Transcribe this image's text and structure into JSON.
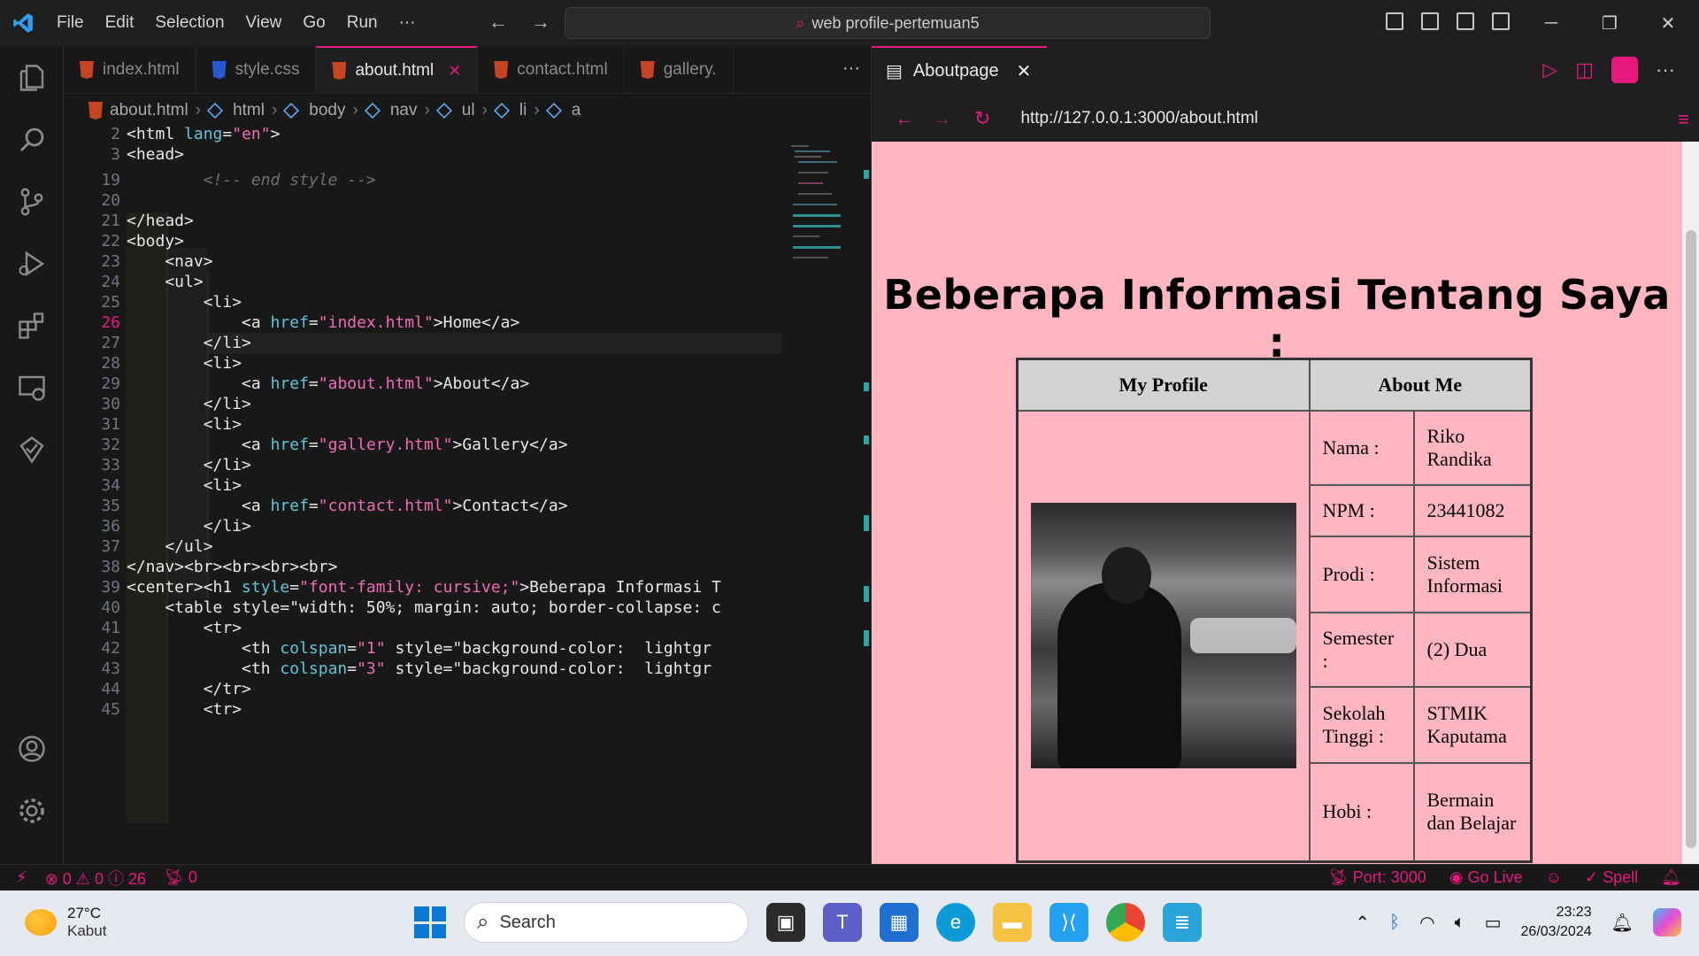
{
  "titlebar": {
    "menu": [
      "File",
      "Edit",
      "Selection",
      "View",
      "Go",
      "Run",
      "···"
    ],
    "search_text": "web profile-pertemuan5"
  },
  "editor": {
    "tabs": [
      {
        "label": "index.html",
        "type": "html"
      },
      {
        "label": "style.css",
        "type": "css"
      },
      {
        "label": "about.html",
        "type": "html",
        "active": true
      },
      {
        "label": "contact.html",
        "type": "html"
      },
      {
        "label": "gallery.",
        "type": "html"
      }
    ],
    "more": "···",
    "breadcrumb": [
      "about.html",
      "html",
      "body",
      "nav",
      "ul",
      "li",
      "a"
    ],
    "lines": [
      {
        "n": "2",
        "code": "<html lang=\"en\">"
      },
      {
        "n": "3",
        "code": "<head>"
      },
      {
        "n": "19",
        "code": "        <!-- end style -->"
      },
      {
        "n": "20",
        "code": ""
      },
      {
        "n": "21",
        "code": "</head>"
      },
      {
        "n": "22",
        "code": "<body>"
      },
      {
        "n": "23",
        "code": "    <nav>"
      },
      {
        "n": "24",
        "code": "    <ul>"
      },
      {
        "n": "25",
        "code": "        <li>"
      },
      {
        "n": "26",
        "code": "            <a href=\"index.html\">Home</a>"
      },
      {
        "n": "27",
        "code": "        </li>"
      },
      {
        "n": "28",
        "code": "        <li>"
      },
      {
        "n": "29",
        "code": "            <a href=\"about.html\">About</a>"
      },
      {
        "n": "30",
        "code": "        </li>"
      },
      {
        "n": "31",
        "code": "        <li>"
      },
      {
        "n": "32",
        "code": "            <a href=\"gallery.html\">Gallery</a>"
      },
      {
        "n": "33",
        "code": "        </li>"
      },
      {
        "n": "34",
        "code": "        <li>"
      },
      {
        "n": "35",
        "code": "            <a href=\"contact.html\">Contact</a>"
      },
      {
        "n": "36",
        "code": "        </li>"
      },
      {
        "n": "37",
        "code": "    </ul>"
      },
      {
        "n": "38",
        "code": "</nav><br><br><br><br>"
      },
      {
        "n": "39",
        "code": "<center><h1 style=\"font-family: cursive;\">Beberapa Informasi T"
      },
      {
        "n": "40",
        "code": "    <table style=\"width: 50%; margin: auto; border-collapse: c"
      },
      {
        "n": "41",
        "code": "        <tr>"
      },
      {
        "n": "42",
        "code": "            <th colspan=\"1\" style=\"background-color:  lightgr"
      },
      {
        "n": "43",
        "code": "            <th colspan=\"3\" style=\"background-color:  lightgr"
      },
      {
        "n": "44",
        "code": "        </tr>"
      },
      {
        "n": "45",
        "code": "        <tr>"
      }
    ]
  },
  "preview": {
    "tab_label": "Aboutpage",
    "url": "http://127.0.0.1:3000/about.html",
    "heading": "Beberapa Informasi Tentang Saya :",
    "table_headers": [
      "My Profile",
      "About Me"
    ],
    "rows": [
      {
        "label": "Nama :",
        "value": "Riko Randika"
      },
      {
        "label": "NPM :",
        "value": "23441082"
      },
      {
        "label": "Prodi :",
        "value": "Sistem Informasi"
      },
      {
        "label": "Semester :",
        "value": "(2) Dua"
      },
      {
        "label": "Sekolah Tinggi :",
        "value": "STMIK Kaputama"
      },
      {
        "label": "Hobi :",
        "value": "Bermain dan Belajar"
      }
    ]
  },
  "statusbar": {
    "errors": "0",
    "warnings": "0",
    "info": "26",
    "ports_count": "0",
    "port": "Port: 3000",
    "golive": "Go Live",
    "spell": "Spell"
  },
  "taskbar": {
    "temp": "27°C",
    "weather": "Kabut",
    "search": "Search",
    "time": "23:23",
    "date": "26/03/2024"
  },
  "colors": {
    "accent": "#e5197c",
    "page_bg": "#ffb6c1"
  }
}
